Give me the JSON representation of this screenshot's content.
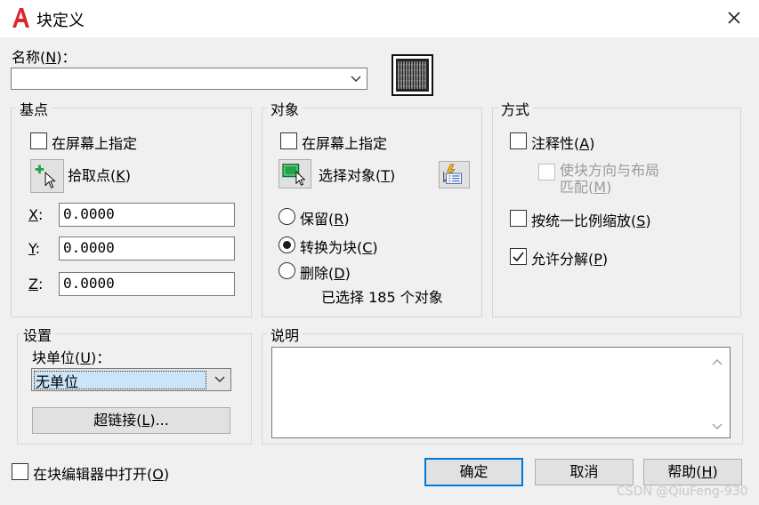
{
  "window": {
    "title": "块定义"
  },
  "name": {
    "label_prefix": "名称(",
    "label_key": "N",
    "label_suffix": ")：",
    "value": ""
  },
  "basepoint": {
    "title": "基点",
    "onscreen_label": "在屏幕上指定",
    "onscreen_checked": false,
    "pick_label_prefix": "拾取点(",
    "pick_key": "K",
    "pick_label_suffix": ")",
    "x_key": "X",
    "y_key": "Y",
    "z_key": "Z",
    "coord_colon": ":",
    "x": "0.0000",
    "y": "0.0000",
    "z": "0.0000"
  },
  "objects": {
    "title": "对象",
    "onscreen_label": "在屏幕上指定",
    "onscreen_checked": false,
    "select_label_prefix": "选择对象(",
    "select_key": "T",
    "select_label_suffix": ")",
    "retain_prefix": "保留(",
    "retain_key": "R",
    "retain_suffix": ")",
    "convert_prefix": "转换为块(",
    "convert_key": "C",
    "convert_suffix": ")",
    "delete_prefix": "删除(",
    "delete_key": "D",
    "delete_suffix": ")",
    "selected_option": "convert",
    "selection_count_text": "已选择 185 个对象"
  },
  "behavior": {
    "title": "方式",
    "annotative_prefix": "注释性(",
    "annotative_key": "A",
    "annotative_suffix": ")",
    "annotative_checked": false,
    "match_line1": "使块方向与布局",
    "match_line2_prefix": "匹配(",
    "match_key": "M",
    "match_line2_suffix": ")",
    "match_checked": false,
    "uniform_prefix": "按统一比例缩放(",
    "uniform_key": "S",
    "uniform_suffix": ")",
    "uniform_checked": false,
    "explode_prefix": "允许分解(",
    "explode_key": "P",
    "explode_suffix": ")",
    "explode_checked": true
  },
  "settings": {
    "title": "设置",
    "unit_label_prefix": "块单位(",
    "unit_key": "U",
    "unit_label_suffix": ")：",
    "unit_value": "无单位",
    "hyperlink_prefix": "超链接(",
    "hyperlink_key": "L",
    "hyperlink_suffix": ")..."
  },
  "description": {
    "title": "说明",
    "value": ""
  },
  "footer": {
    "open_editor_prefix": "在块编辑器中打开(",
    "open_editor_key": "O",
    "open_editor_suffix": ")",
    "open_editor_checked": false,
    "ok_label": "确定",
    "cancel_label": "取消",
    "help_prefix": "帮助(",
    "help_key": "H",
    "help_suffix": ")"
  },
  "watermark": "CSDN @QiuFeng-930",
  "colors": {
    "accent": "#0078d7",
    "app_icon": "#e0262d",
    "pick_icon_green": "#22a34a"
  }
}
